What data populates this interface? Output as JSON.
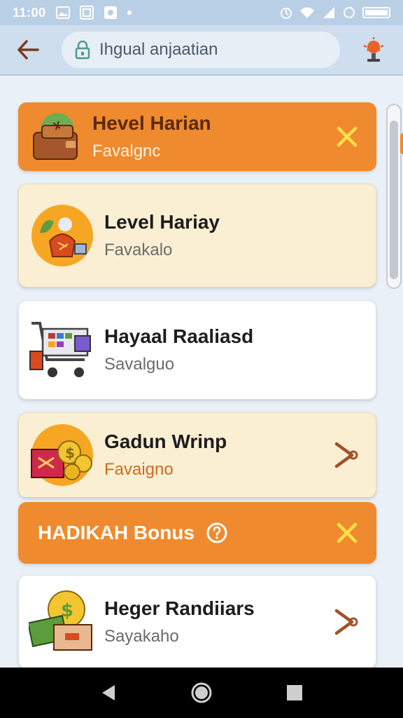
{
  "status_bar": {
    "time": "11:00",
    "icons": [
      "photo-icon",
      "portrait-icon",
      "app-icon",
      "wifi-icon",
      "signal-icon",
      "battery-icon"
    ]
  },
  "app_bar": {
    "search_text": "Ihgual anjaatian",
    "icons": [
      "back-arrow-icon",
      "lock-icon",
      "lamp-icon"
    ]
  },
  "colors": {
    "accent": "#f08a2e",
    "cream": "#fbefd3",
    "header": "#cfdeee",
    "close": "#ffe14a",
    "chevron": "#a0522d"
  },
  "items": [
    {
      "title": "Hevel Harian",
      "subtitle": "Favalgnc",
      "icon": "wallet-icon",
      "trail": "close-icon"
    },
    {
      "title": "Level Hariay",
      "subtitle": "Favakalo",
      "icon": "fruit-bag-icon",
      "trail": ""
    },
    {
      "title": "Hayaal Raaliasd",
      "subtitle": "Savalguo",
      "icon": "shopping-cart-icon",
      "trail": ""
    },
    {
      "title": "Gadun Wrinp",
      "subtitle": "Favaigno",
      "icon": "gift-coins-icon",
      "trail": "chevron-icon"
    },
    {
      "title": "HADIKAH Bonus",
      "subtitle": "",
      "icon": "help-icon",
      "trail": "close-icon"
    },
    {
      "title": "Heger Randiiars",
      "subtitle": "Sayakaho",
      "icon": "money-icon",
      "trail": "chevron-icon"
    }
  ],
  "nav": [
    "back-triangle-icon",
    "home-circle-icon",
    "recents-square-icon"
  ]
}
